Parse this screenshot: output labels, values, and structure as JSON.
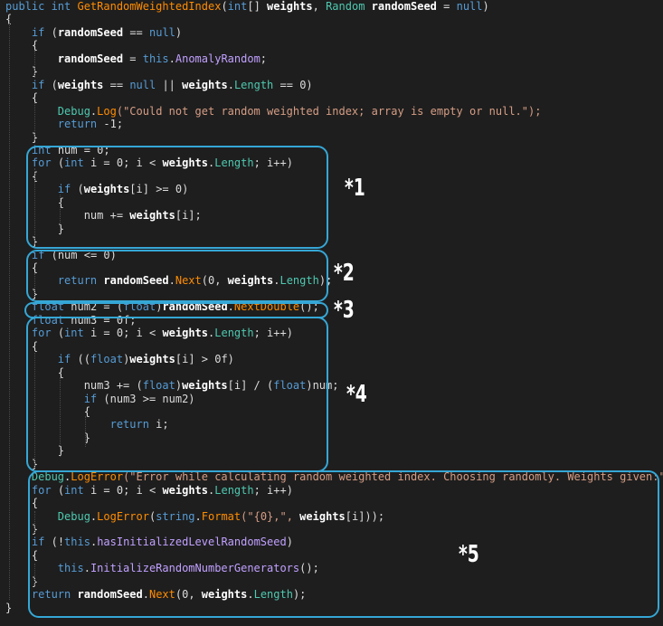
{
  "code_lines": [
    [
      [
        "public ",
        "kw"
      ],
      [
        "int ",
        "kw"
      ],
      [
        "GetRandomWeightedIndex",
        "mt"
      ],
      [
        "(",
        "pl"
      ],
      [
        "int",
        "kw"
      ],
      [
        "[] ",
        "pl"
      ],
      [
        "weights",
        "pm"
      ],
      [
        ", ",
        "pl"
      ],
      [
        "Random ",
        "ty"
      ],
      [
        "randomSeed ",
        "pm"
      ],
      [
        "= ",
        "pl"
      ],
      [
        "null",
        "kw"
      ],
      [
        ")",
        "pl"
      ]
    ],
    [
      [
        "{",
        "pl"
      ]
    ],
    [
      [
        "    ",
        "pl"
      ],
      [
        "if ",
        "kw"
      ],
      [
        "(",
        "pl"
      ],
      [
        "randomSeed ",
        "pm"
      ],
      [
        "== ",
        "pl"
      ],
      [
        "null",
        "kw"
      ],
      [
        ")",
        "pl"
      ]
    ],
    [
      [
        "    {",
        "pl"
      ]
    ],
    [
      [
        "        ",
        "pl"
      ],
      [
        "randomSeed ",
        "pm"
      ],
      [
        "= ",
        "pl"
      ],
      [
        "this",
        "kw"
      ],
      [
        ".",
        "pl"
      ],
      [
        "AnomalyRandom",
        "pr"
      ],
      [
        ";",
        "pl"
      ]
    ],
    [
      [
        "    }",
        "pl"
      ]
    ],
    [
      [
        "    ",
        "pl"
      ],
      [
        "if ",
        "kw"
      ],
      [
        "(",
        "pl"
      ],
      [
        "weights ",
        "pm"
      ],
      [
        "== ",
        "pl"
      ],
      [
        "null ",
        "kw"
      ],
      [
        "|| ",
        "pl"
      ],
      [
        "weights",
        "pm"
      ],
      [
        ".",
        "pl"
      ],
      [
        "Length ",
        "ty"
      ],
      [
        "== 0)",
        "pl"
      ]
    ],
    [
      [
        "    {",
        "pl"
      ]
    ],
    [
      [
        "        ",
        "pl"
      ],
      [
        "Debug",
        "ty"
      ],
      [
        ".",
        "pl"
      ],
      [
        "Log",
        "mt"
      ],
      [
        "(\"Could not get random weighted index; array is empty or null.\");",
        "st"
      ]
    ],
    [
      [
        "        ",
        "pl"
      ],
      [
        "return ",
        "kw"
      ],
      [
        "-1;",
        "pl"
      ]
    ],
    [
      [
        "    }",
        "pl"
      ]
    ],
    [
      [
        "    ",
        "pl"
      ],
      [
        "int ",
        "kw"
      ],
      [
        "num = 0;",
        "pl"
      ]
    ],
    [
      [
        "    ",
        "pl"
      ],
      [
        "for ",
        "kw"
      ],
      [
        "(",
        "pl"
      ],
      [
        "int ",
        "kw"
      ],
      [
        "i = 0; i < ",
        "pl"
      ],
      [
        "weights",
        "pm"
      ],
      [
        ".",
        "pl"
      ],
      [
        "Length",
        "ty"
      ],
      [
        "; i++)",
        "pl"
      ]
    ],
    [
      [
        "    {",
        "pl"
      ]
    ],
    [
      [
        "        ",
        "pl"
      ],
      [
        "if ",
        "kw"
      ],
      [
        "(",
        "pl"
      ],
      [
        "weights",
        "pm"
      ],
      [
        "[i] >= 0)",
        "pl"
      ]
    ],
    [
      [
        "        {",
        "pl"
      ]
    ],
    [
      [
        "            num += ",
        "pl"
      ],
      [
        "weights",
        "pm"
      ],
      [
        "[i];",
        "pl"
      ]
    ],
    [
      [
        "        }",
        "pl"
      ]
    ],
    [
      [
        "    }",
        "pl"
      ]
    ],
    [
      [
        "    ",
        "pl"
      ],
      [
        "if ",
        "kw"
      ],
      [
        "(num <= 0)",
        "pl"
      ]
    ],
    [
      [
        "    {",
        "pl"
      ]
    ],
    [
      [
        "        ",
        "pl"
      ],
      [
        "return ",
        "kw"
      ],
      [
        "randomSeed",
        "pm"
      ],
      [
        ".",
        "pl"
      ],
      [
        "Next",
        "mt"
      ],
      [
        "(0, ",
        "pl"
      ],
      [
        "weights",
        "pm"
      ],
      [
        ".",
        "pl"
      ],
      [
        "Length",
        "ty"
      ],
      [
        ");",
        "pl"
      ]
    ],
    [
      [
        "    }",
        "pl"
      ]
    ],
    [
      [
        "    ",
        "pl"
      ],
      [
        "float ",
        "kw"
      ],
      [
        "num2 = (",
        "pl"
      ],
      [
        "float",
        "kw"
      ],
      [
        ")",
        "pl"
      ],
      [
        "randomSeed",
        "pm"
      ],
      [
        ".",
        "pl"
      ],
      [
        "NextDouble",
        "mt"
      ],
      [
        "();",
        "pl"
      ]
    ],
    [
      [
        "    ",
        "pl"
      ],
      [
        "float ",
        "kw"
      ],
      [
        "num3 = 0f;",
        "pl"
      ]
    ],
    [
      [
        "    ",
        "pl"
      ],
      [
        "for ",
        "kw"
      ],
      [
        "(",
        "pl"
      ],
      [
        "int ",
        "kw"
      ],
      [
        "i = 0; i < ",
        "pl"
      ],
      [
        "weights",
        "pm"
      ],
      [
        ".",
        "pl"
      ],
      [
        "Length",
        "ty"
      ],
      [
        "; i++)",
        "pl"
      ]
    ],
    [
      [
        "    {",
        "pl"
      ]
    ],
    [
      [
        "        ",
        "pl"
      ],
      [
        "if ",
        "kw"
      ],
      [
        "((",
        "pl"
      ],
      [
        "float",
        "kw"
      ],
      [
        ")",
        "pl"
      ],
      [
        "weights",
        "pm"
      ],
      [
        "[i] > 0f)",
        "pl"
      ]
    ],
    [
      [
        "        {",
        "pl"
      ]
    ],
    [
      [
        "            num3 += (",
        "pl"
      ],
      [
        "float",
        "kw"
      ],
      [
        ")",
        "pl"
      ],
      [
        "weights",
        "pm"
      ],
      [
        "[i] / (",
        "pl"
      ],
      [
        "float",
        "kw"
      ],
      [
        ")num;",
        "pl"
      ]
    ],
    [
      [
        "            ",
        "pl"
      ],
      [
        "if ",
        "kw"
      ],
      [
        "(num3 >= num2)",
        "pl"
      ]
    ],
    [
      [
        "            {",
        "pl"
      ]
    ],
    [
      [
        "                ",
        "pl"
      ],
      [
        "return ",
        "kw"
      ],
      [
        "i;",
        "pl"
      ]
    ],
    [
      [
        "            }",
        "pl"
      ]
    ],
    [
      [
        "        }",
        "pl"
      ]
    ],
    [
      [
        "    }",
        "pl"
      ]
    ],
    [
      [
        "    ",
        "pl"
      ],
      [
        "Debug",
        "ty"
      ],
      [
        ".",
        "pl"
      ],
      [
        "LogError",
        "mt"
      ],
      [
        "(\"Error while calculating random weighted index. Choosing randomly. Weights given:\");",
        "st"
      ]
    ],
    [
      [
        "    ",
        "pl"
      ],
      [
        "for ",
        "kw"
      ],
      [
        "(",
        "pl"
      ],
      [
        "int ",
        "kw"
      ],
      [
        "i = 0; i < ",
        "pl"
      ],
      [
        "weights",
        "pm"
      ],
      [
        ".",
        "pl"
      ],
      [
        "Length",
        "ty"
      ],
      [
        "; i++)",
        "pl"
      ]
    ],
    [
      [
        "    {",
        "pl"
      ]
    ],
    [
      [
        "        ",
        "pl"
      ],
      [
        "Debug",
        "ty"
      ],
      [
        ".",
        "pl"
      ],
      [
        "LogError",
        "mt"
      ],
      [
        "(",
        "pl"
      ],
      [
        "string",
        "kw"
      ],
      [
        ".",
        "pl"
      ],
      [
        "Format",
        "mt"
      ],
      [
        "(\"{0},\", ",
        "st"
      ],
      [
        "weights",
        "pm"
      ],
      [
        "[i]));",
        "pl"
      ]
    ],
    [
      [
        "    }",
        "pl"
      ]
    ],
    [
      [
        "    ",
        "pl"
      ],
      [
        "if ",
        "kw"
      ],
      [
        "(!",
        "pl"
      ],
      [
        "this",
        "kw"
      ],
      [
        ".",
        "pl"
      ],
      [
        "hasInitializedLevelRandomSeed",
        "pr"
      ],
      [
        ")",
        "pl"
      ]
    ],
    [
      [
        "    {",
        "pl"
      ]
    ],
    [
      [
        "        ",
        "pl"
      ],
      [
        "this",
        "kw"
      ],
      [
        ".",
        "pl"
      ],
      [
        "InitializeRandomNumberGenerators",
        "pr"
      ],
      [
        "();",
        "pl"
      ]
    ],
    [
      [
        "    }",
        "pl"
      ]
    ],
    [
      [
        "    ",
        "pl"
      ],
      [
        "return ",
        "kw"
      ],
      [
        "randomSeed",
        "pm"
      ],
      [
        ".",
        "pl"
      ],
      [
        "Next",
        "mt"
      ],
      [
        "(0, ",
        "pl"
      ],
      [
        "weights",
        "pm"
      ],
      [
        ".",
        "pl"
      ],
      [
        "Length",
        "ty"
      ],
      [
        ");",
        "pl"
      ]
    ],
    [
      [
        "}",
        "pl"
      ]
    ]
  ],
  "annotations": {
    "mark1": "*1",
    "mark2": "*2",
    "mark3": "*3",
    "mark4": "*4",
    "mark5": "*5"
  },
  "colors": {
    "background": "#1e1e1e",
    "highlight_box": "#35a7d6",
    "keyword": "#569cd6",
    "type": "#4ec9b0",
    "method": "#ff8c00",
    "property": "#c0a0ff",
    "string": "#d69d85"
  }
}
